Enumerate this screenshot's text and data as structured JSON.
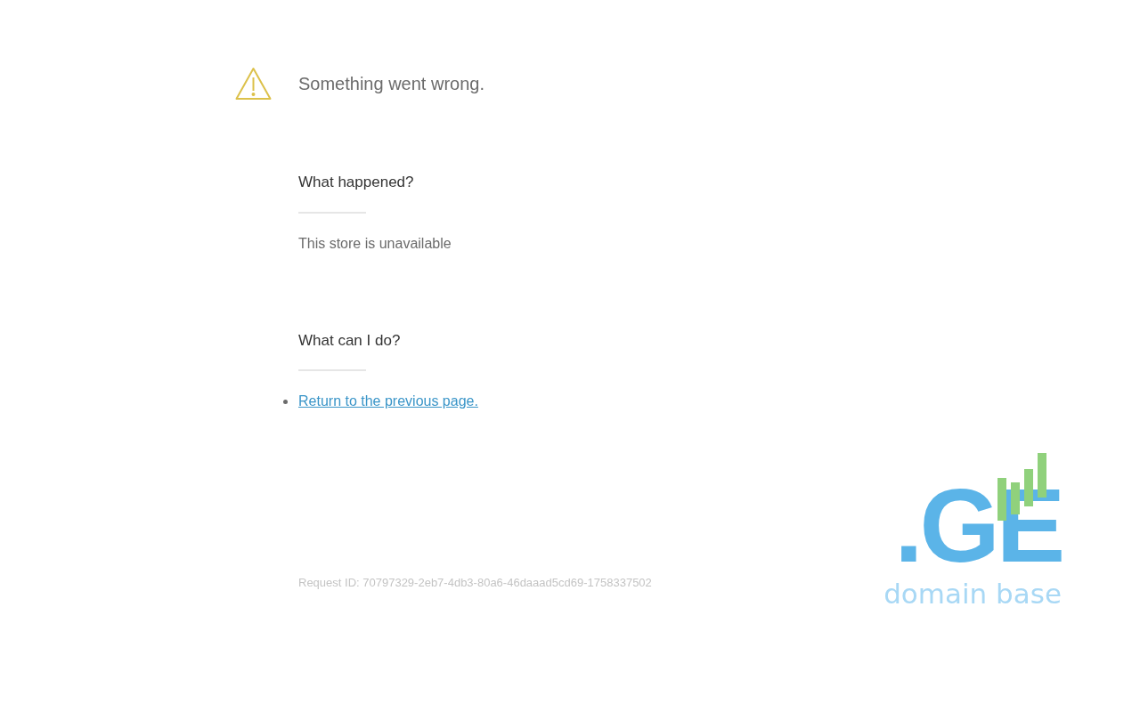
{
  "title": "Something went wrong.",
  "sections": [
    {
      "heading": "What happened?",
      "body": "This store is unavailable"
    },
    {
      "heading": "What can I do?",
      "links": [
        "Return to the previous page."
      ]
    }
  ],
  "request_id": "Request ID: 70797329-2eb7-4db3-80a6-46daaad5cd69-1758337502",
  "logo": {
    "mark": ".GE",
    "tagline": "domain base"
  }
}
